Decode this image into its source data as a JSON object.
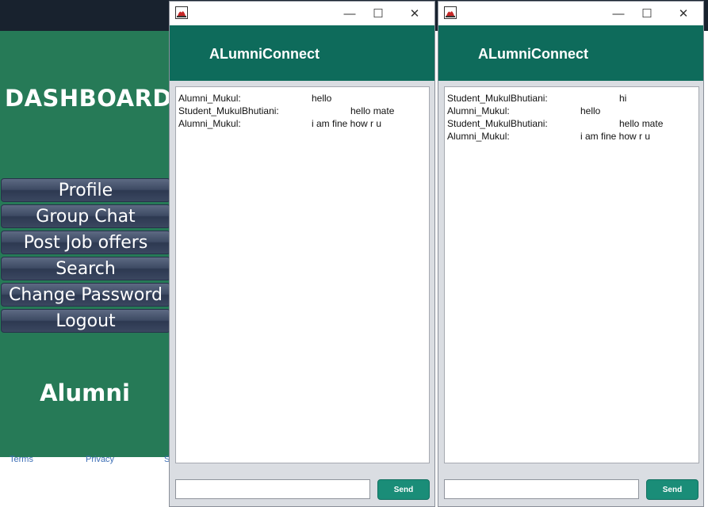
{
  "dashboard": {
    "title": "DASHBOARD",
    "nav": [
      "Profile",
      "Group Chat",
      "Post Job offers",
      "Search",
      "Change Password",
      "Logout"
    ],
    "role": "Alumni",
    "footer_links": [
      "Terms",
      "Privacy",
      "S"
    ]
  },
  "window1": {
    "app_title": "ALumniConnect",
    "controls": {
      "minimize": "—",
      "maximize": "☐",
      "close": "✕"
    },
    "messages": [
      {
        "sender": "Alumni_Mukul:",
        "text": "hello"
      },
      {
        "sender": "Student_MukulBhutiani:",
        "text": "hello mate"
      },
      {
        "sender": "Alumni_Mukul:",
        "text": "i am fine how r u"
      }
    ],
    "input_value": "",
    "send_label": "Send"
  },
  "window2": {
    "app_title": "ALumniConnect",
    "controls": {
      "minimize": "—",
      "maximize": "☐",
      "close": "✕"
    },
    "messages": [
      {
        "sender": "Student_MukulBhutiani:",
        "text": "hi"
      },
      {
        "sender": "Alumni_Mukul:",
        "text": "hello"
      },
      {
        "sender": "Student_MukulBhutiani:",
        "text": "hello mate"
      },
      {
        "sender": "Alumni_Mukul:",
        "text": "i am fine how r u"
      }
    ],
    "input_value": "",
    "send_label": "Send"
  }
}
